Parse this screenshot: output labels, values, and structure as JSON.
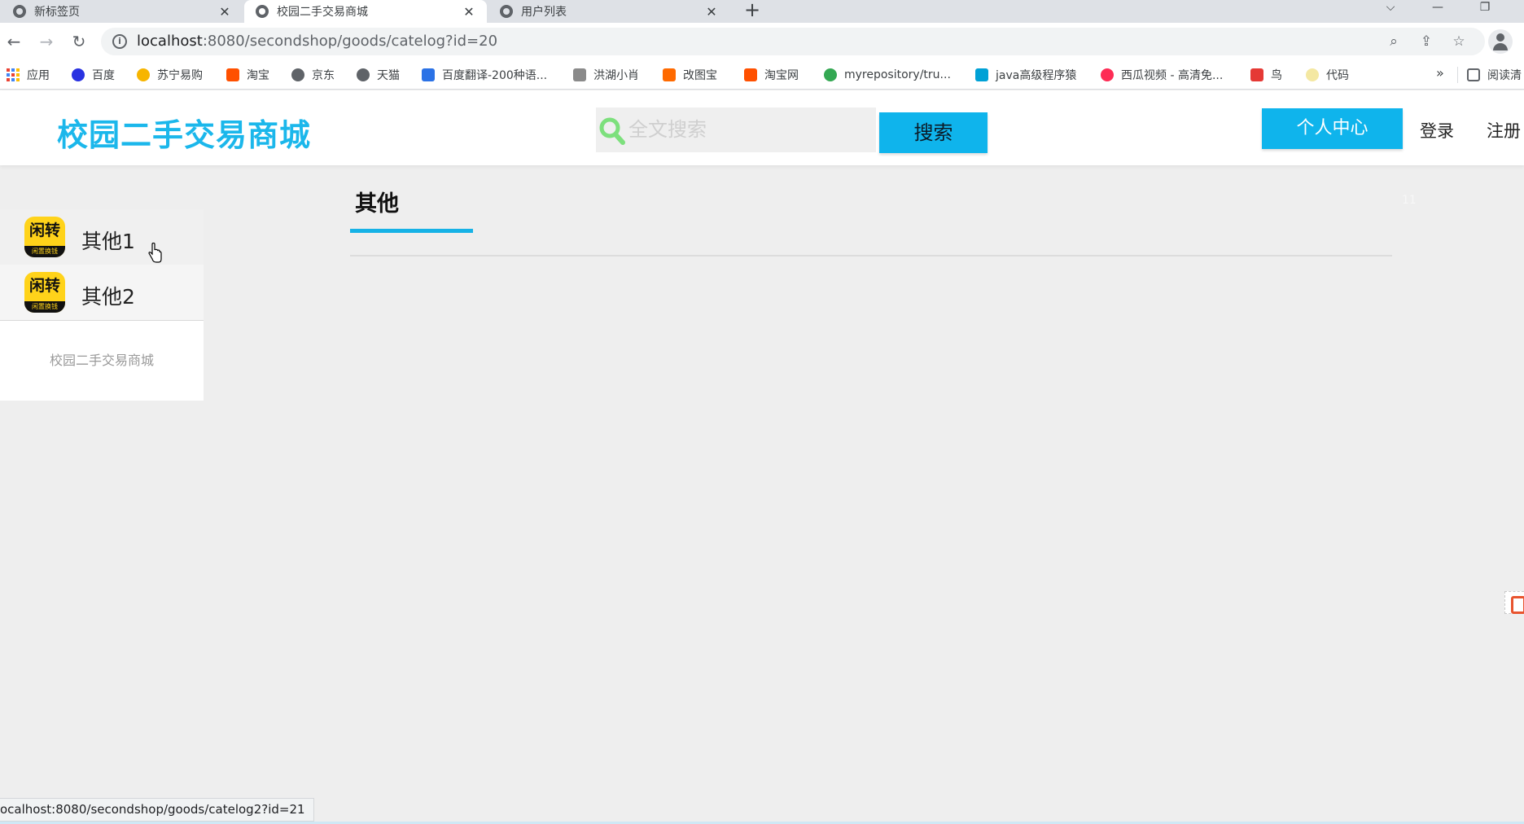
{
  "browser": {
    "tabs": [
      {
        "title": "新标签页",
        "active": false
      },
      {
        "title": "校园二手交易商城",
        "active": true
      },
      {
        "title": "用户列表",
        "active": false
      }
    ],
    "new_tab_symbol": "+",
    "close_symbol": "✕",
    "url_host": "localhost",
    "url_rest": ":8080/secondshop/goods/catelog?id=20",
    "bookmarks": [
      {
        "label": "应用",
        "icon": "apps-grid-icon",
        "color": "#ea4335"
      },
      {
        "label": "百度",
        "icon": "baidu-paw-icon",
        "color": "#2932e1"
      },
      {
        "label": "苏宁易购",
        "icon": "suning-lion-icon",
        "color": "#f7b500"
      },
      {
        "label": "淘宝",
        "icon": "taobao-icon",
        "color": "#ff5000"
      },
      {
        "label": "京东",
        "icon": "globe-icon",
        "color": "#5f6368"
      },
      {
        "label": "天猫",
        "icon": "globe-icon",
        "color": "#5f6368"
      },
      {
        "label": "百度翻译-200种语...",
        "icon": "baidu-translate-icon",
        "color": "#2b72e6"
      },
      {
        "label": "洪湖小肖",
        "icon": "bookmark-bird-icon",
        "color": "#8a8a8a"
      },
      {
        "label": "改图宝",
        "icon": "gaitubao-icon",
        "color": "#ff6a00"
      },
      {
        "label": "淘宝网",
        "icon": "taobao-icon",
        "color": "#ff5000"
      },
      {
        "label": "myrepository/tru...",
        "icon": "chrome-icon",
        "color": "#34a853"
      },
      {
        "label": "java高级程序猿",
        "icon": "bilibili-icon",
        "color": "#00a1d6"
      },
      {
        "label": "西瓜视频 - 高清免...",
        "icon": "xigua-play-icon",
        "color": "#fe2c55"
      },
      {
        "label": "鸟",
        "icon": "bird-icon",
        "color": "#e53935"
      },
      {
        "label": "代码",
        "icon": "bookmark-icon",
        "color": "#f4e8a2"
      }
    ],
    "bookmarks_more": "»",
    "reading_list": "阅读清"
  },
  "header": {
    "logo": "校园二手交易商城",
    "search_placeholder": "全文搜索",
    "search_button": "搜索",
    "user_center": "个人中心",
    "login": "登录",
    "register": "注册"
  },
  "sidebar": {
    "items": [
      {
        "label": "其他1",
        "icon_text": "闲转",
        "icon_sub": "闲置换钱"
      },
      {
        "label": "其他2",
        "icon_text": "闲转",
        "icon_sub": "闲置换钱"
      }
    ],
    "footer": "校园二手交易商城"
  },
  "main": {
    "title": "其他",
    "faint_count": "11"
  },
  "status_bar": {
    "link": "ocalhost:8080/secondshop/goods/catelog2?id=21"
  },
  "colors": {
    "brand": "#1bb7eb",
    "button": "#0fb4ec",
    "search_icon": "#7de07d",
    "app_icon_bg": "#ffd31a"
  }
}
